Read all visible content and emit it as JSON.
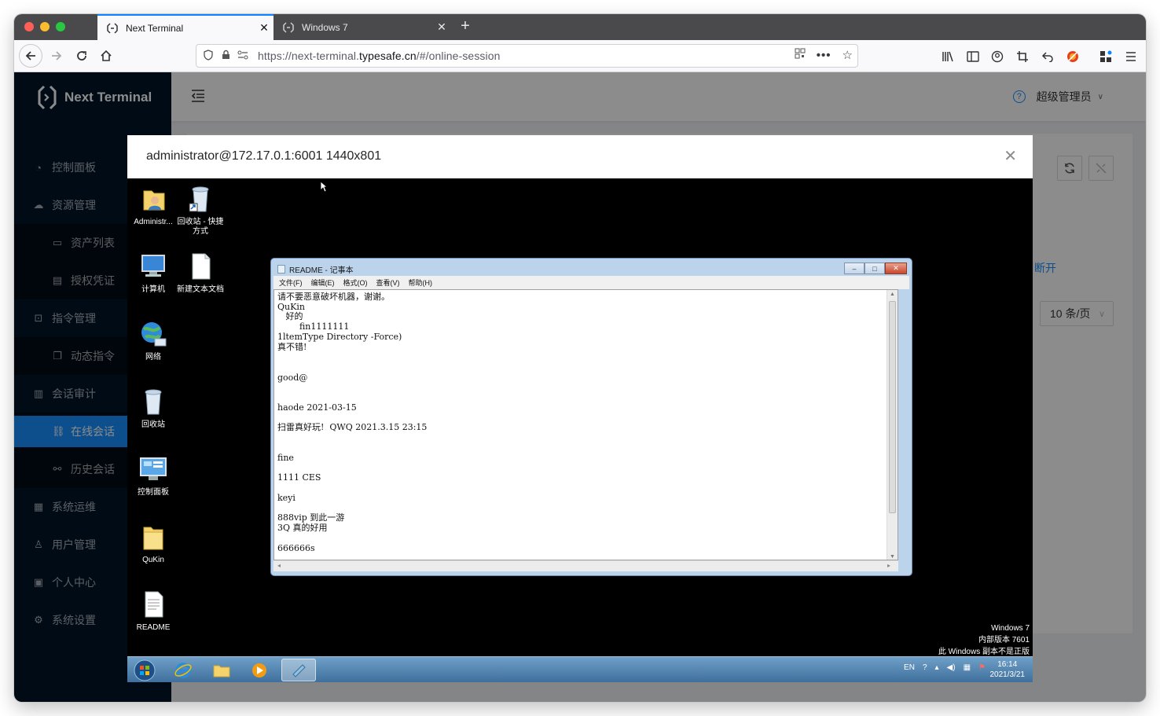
{
  "browser": {
    "tabs": [
      {
        "label": "Next Terminal",
        "active": true
      },
      {
        "label": "Windows 7",
        "active": false
      }
    ],
    "url_prefix": "https://next-terminal.",
    "url_domain": "typesafe.cn",
    "url_suffix": "/#/online-session"
  },
  "app": {
    "brand": "Next Terminal",
    "user": "超级管理员",
    "menu": [
      {
        "label": "控制面板",
        "icon": "dashboard-icon"
      },
      {
        "label": "资源管理",
        "icon": "cloud-icon"
      },
      {
        "label": "资产列表",
        "icon": "desktop-icon"
      },
      {
        "label": "授权凭证",
        "icon": "id-card-icon"
      },
      {
        "label": "指令管理",
        "icon": "code-icon"
      },
      {
        "label": "动态指令",
        "icon": "copy-icon"
      },
      {
        "label": "会话审计",
        "icon": "audit-icon"
      },
      {
        "label": "在线会话",
        "icon": "link-icon"
      },
      {
        "label": "历史会话",
        "icon": "disconnect-icon"
      },
      {
        "label": "系统运维",
        "icon": "control-icon"
      },
      {
        "label": "用户管理",
        "icon": "user-icon"
      },
      {
        "label": "个人中心",
        "icon": "profile-icon"
      },
      {
        "label": "系统设置",
        "icon": "setting-icon"
      }
    ],
    "disconnect_link": "断开",
    "page_size": "10 条/页"
  },
  "modal": {
    "title": "administrator@172.17.0.1:6001 1440x801"
  },
  "desktop": {
    "icons": [
      {
        "label": "Administr...",
        "icon": "user-folder-icon"
      },
      {
        "label": "回收站 - 快捷方式",
        "icon": "recycle-bin-shortcut-icon"
      },
      {
        "label": "计算机",
        "icon": "computer-icon"
      },
      {
        "label": "新建文本文档",
        "icon": "text-document-icon"
      },
      {
        "label": "网络",
        "icon": "network-icon"
      },
      {
        "label": "回收站",
        "icon": "recycle-bin-icon"
      },
      {
        "label": "控制面板",
        "icon": "control-panel-icon"
      },
      {
        "label": "QuKin",
        "icon": "folder-icon"
      },
      {
        "label": "README",
        "icon": "readme-document-icon"
      }
    ],
    "notepad": {
      "title": "README - 记事本",
      "menu": [
        "文件(F)",
        "编辑(E)",
        "格式(O)",
        "查看(V)",
        "帮助(H)"
      ],
      "lines": [
        "请不要恶意破坏机器，谢谢。",
        "QuKin",
        "   好的",
        "        fin1111111",
        "1ltemType Directory -Force)",
        "真不错!",
        "good@",
        "haode 2021-03-15",
        "扫雷真好玩!  QWQ 2021.3.15 23:15",
        "fine",
        "1111 CES",
        "keyi",
        "888vip 到此一游",
        "3Q 真的好用",
        "666666s"
      ]
    },
    "watermark": [
      "Windows 7",
      "内部版本 7601",
      "此 Windows 副本不是正版"
    ],
    "clock_time": "16:14",
    "clock_date": "2021/3/21",
    "tray_lang": "EN"
  }
}
